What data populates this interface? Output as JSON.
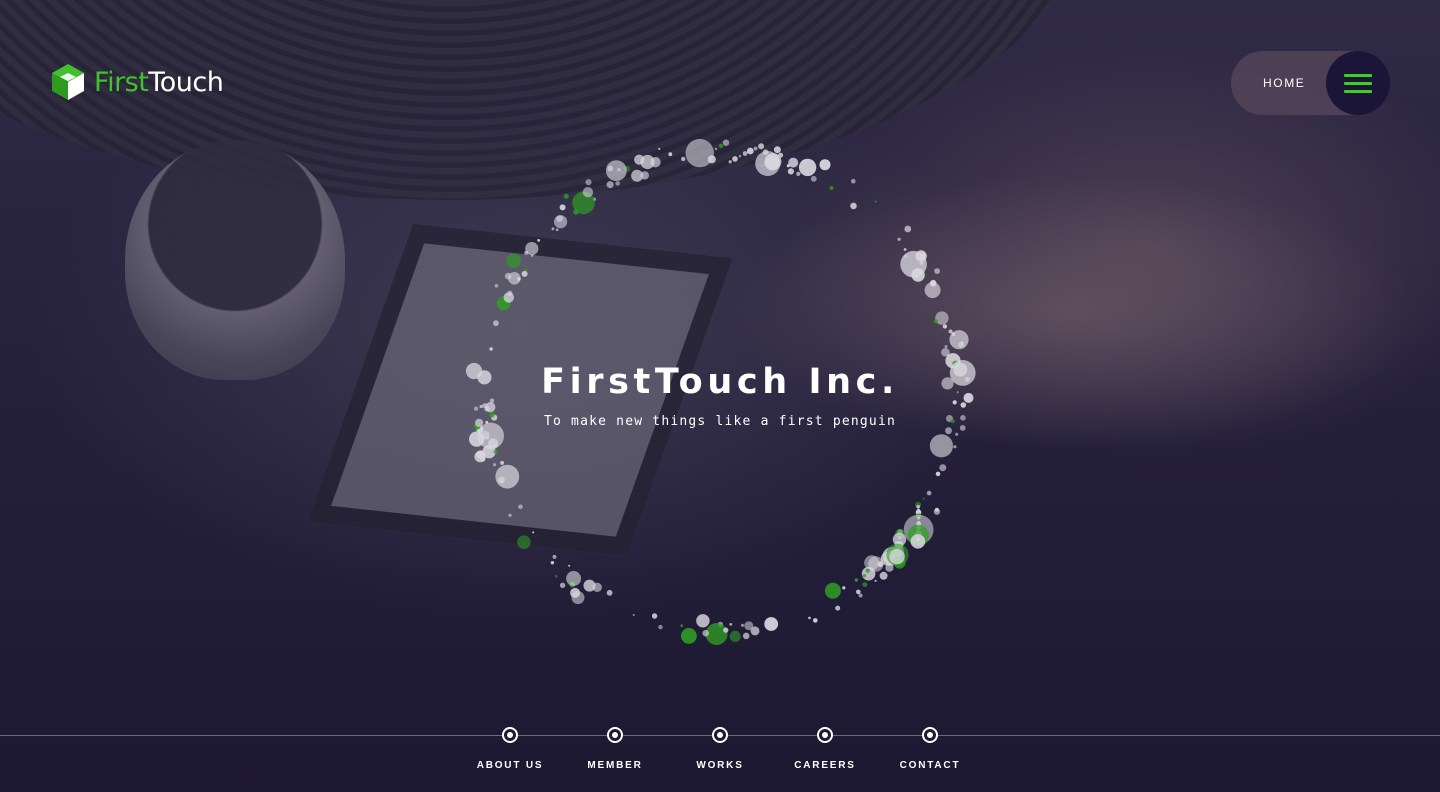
{
  "brand": {
    "name_part1": "First",
    "name_part2": "Touch",
    "accent_color": "#41c12d"
  },
  "header": {
    "nav_label": "HOME",
    "menu_icon": "hamburger-icon"
  },
  "hero": {
    "title": "FirstTouch Inc.",
    "tagline": "To make new things like a first penguin",
    "background_image": "turntable-finger-photo"
  },
  "sections": [
    {
      "label": "ABOUT US"
    },
    {
      "label": "MEMBER"
    },
    {
      "label": "WORKS"
    },
    {
      "label": "CAREERS"
    },
    {
      "label": "CONTACT"
    }
  ],
  "colors": {
    "overlay": "#1a1630",
    "menu_button_bg": "#1b1538",
    "menu_lines": "#3fcf22",
    "particle_white": "#d9d7df",
    "particle_green": "#2f9e22"
  }
}
